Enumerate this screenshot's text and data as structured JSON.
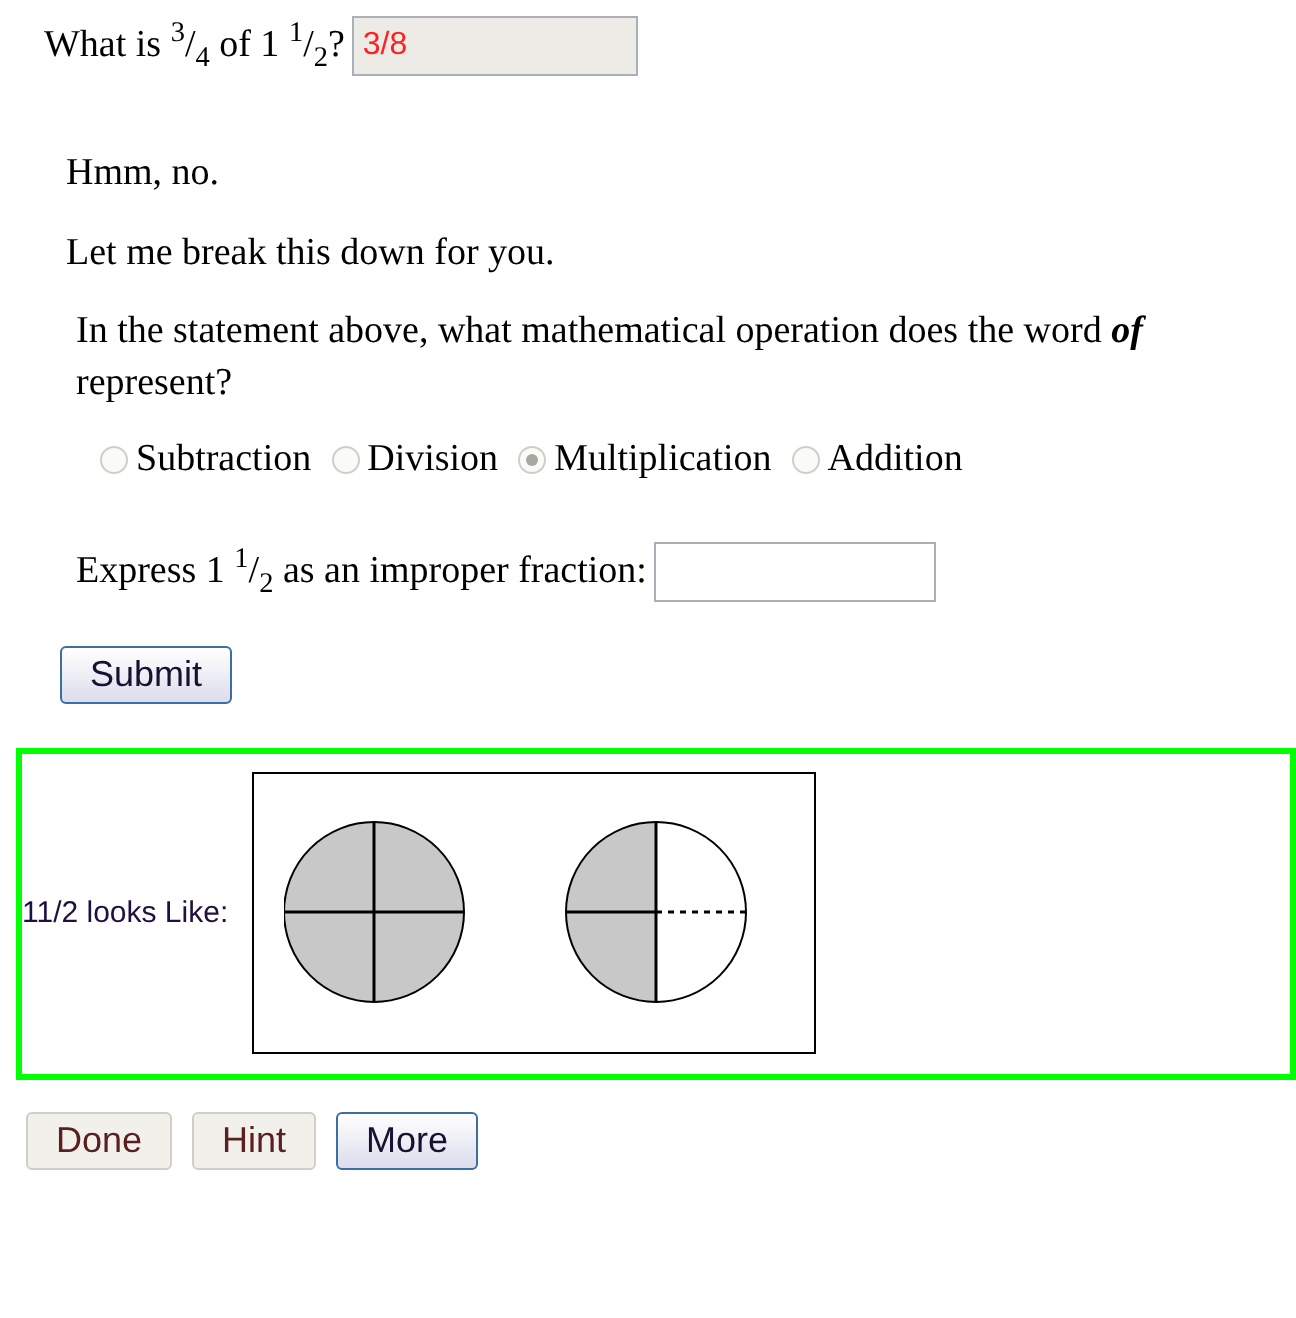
{
  "question": {
    "text": "What is $^{3}$/$_{4}$ of 1 $^{1}$/$_{2}$?",
    "answer": {
      "value": "3/8",
      "disabled": true
    }
  },
  "feedback": [
    "Hmm, no.",
    "Let me break this down for you."
  ],
  "subquestion": {
    "text": "In the statement above, what mathematical operation does the word **of** represent?",
    "options": [
      {
        "label": "Subtraction",
        "selected": false
      },
      {
        "label": "Division",
        "selected": false
      },
      {
        "label": "Multiplication",
        "selected": true
      },
      {
        "label": "Addition",
        "selected": false
      }
    ]
  },
  "express": {
    "text": "Express 1 $^{1}$/$_{2}$ as an improper fraction:",
    "answer": {
      "disabled": false
    }
  },
  "submit": {
    "label": "Submit",
    "disabled": false
  },
  "hint_box": {
    "label": "11/2 looks Like:"
  },
  "buttons": [
    {
      "label": "Done",
      "disabled": true
    },
    {
      "label": "Hint",
      "disabled": true
    },
    {
      "label": "More",
      "disabled": false
    }
  ]
}
